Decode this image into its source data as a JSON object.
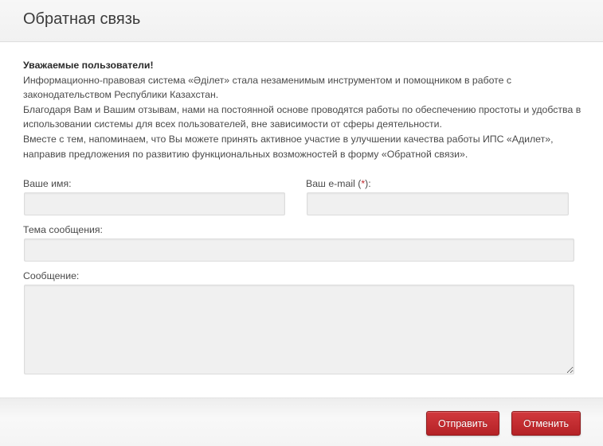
{
  "dialog": {
    "title": "Обратная связь"
  },
  "intro": {
    "heading": "Уважаемые пользователи!",
    "paragraph_1": "Информационно-правовая система «Әділет» стала незаменимым инструментом и помощником в работе с законодательством Республики Казахстан.",
    "paragraph_2": "Благодаря Вам и Вашим отзывам, нами на постоянной основе проводятся работы по обеспечению простоты и удобства в использовании системы для всех пользователей, вне зависимости от сферы деятельности.",
    "paragraph_3": "Вместе с тем, напоминаем, что Вы можете принять активное участие в улучшении качества работы ИПС «Адилет», направив предложения по развитию функциональных возможностей в форму «Обратной связи»."
  },
  "form": {
    "name_label": "Ваше имя:",
    "name_value": "",
    "email_label_prefix": "Ваш e-mail (",
    "email_required_mark": "*",
    "email_label_suffix": "):",
    "email_value": "",
    "subject_label": "Тема сообщения:",
    "subject_value": "",
    "message_label": "Сообщение:",
    "message_value": ""
  },
  "footer": {
    "submit_label": "Отправить",
    "cancel_label": "Отменить"
  },
  "colors": {
    "accent_red": "#c0272d",
    "field_bg": "#f0f0f0"
  }
}
